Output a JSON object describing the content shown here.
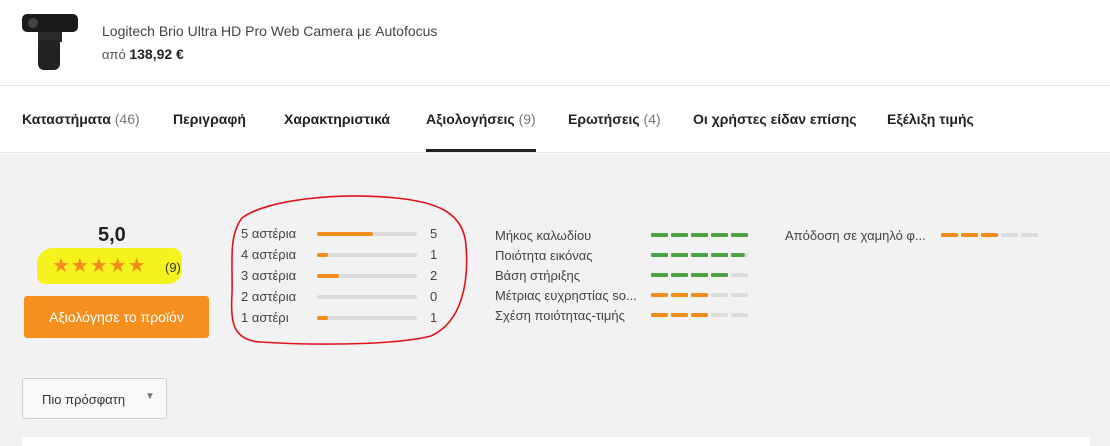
{
  "product": {
    "title": "Logitech Brio Ultra HD Pro Web Camera με Autofocus",
    "price_prefix": "από",
    "price": "138,92 €"
  },
  "tabs": [
    {
      "label": "Καταστήματα",
      "count": "(46)"
    },
    {
      "label": "Περιγραφή",
      "count": ""
    },
    {
      "label": "Χαρακτηριστικά",
      "count": ""
    },
    {
      "label": "Αξιολογήσεις",
      "count": "(9)"
    },
    {
      "label": "Ερωτήσεις",
      "count": "(4)"
    },
    {
      "label": "Οι χρήστες είδαν επίσης",
      "count": ""
    },
    {
      "label": "Εξέλιξη τιμής",
      "count": ""
    }
  ],
  "active_tab": "Αξιολογήσεις",
  "rating": {
    "score": "5,0",
    "stars": "★★★★★",
    "count": "(9)",
    "stars_value": 5
  },
  "rate_button": "Αξιολόγησε το προϊόν",
  "distribution": [
    {
      "label": "5 αστέρια",
      "count": "5",
      "fraction": 0.56
    },
    {
      "label": "4 αστέρια",
      "count": "1",
      "fraction": 0.11
    },
    {
      "label": "3 αστέρια",
      "count": "2",
      "fraction": 0.22
    },
    {
      "label": "2 αστέρια",
      "count": "0",
      "fraction": 0.0
    },
    {
      "label": "1 αστέρι",
      "count": "1",
      "fraction": 0.11
    }
  ],
  "attributes": [
    {
      "label": "Μήκος καλωδίου",
      "level": 5,
      "color": "#4aa244"
    },
    {
      "label": "Ποιότητα εικόνας",
      "level": 4.8,
      "color": "#4aa244"
    },
    {
      "label": "Βάση στήριξης",
      "level": 4,
      "color": "#4aa244"
    },
    {
      "label": "Μέτριας ευχρηστίας so...",
      "level": 3,
      "color": "#f28c1a"
    },
    {
      "label": "Σχέση ποιότητας-τιμής",
      "level": 3,
      "color": "#f28c1a"
    }
  ],
  "attributes_right": [
    {
      "label": "Απόδοση σε χαμηλό φ...",
      "level": 3,
      "color": "#f28c1a"
    }
  ],
  "sort": {
    "value": "Πιο πρόσφατη",
    "icon": "caret-down-icon"
  },
  "colors": {
    "accent": "#f5901f",
    "highlight": "#f6f21e",
    "annotation": "#e0131b",
    "good": "#4aa244",
    "medium": "#f28c1a"
  }
}
